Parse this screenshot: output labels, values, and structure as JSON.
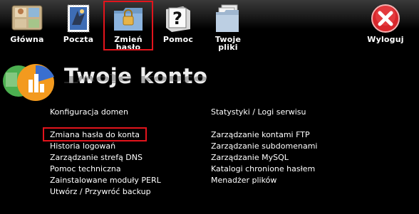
{
  "toolbar": {
    "items": [
      {
        "label": "Główna",
        "icon": "home-photos-icon"
      },
      {
        "label": "Poczta",
        "icon": "mail-stamp-icon"
      },
      {
        "label": "Zmień\nhasło",
        "icon": "folder-password-icon"
      },
      {
        "label": "Pomoc",
        "icon": "help-question-icon"
      },
      {
        "label": "Twoje\npliki",
        "icon": "files-folder-icon"
      },
      {
        "label": "Wyloguj",
        "icon": "logout-close-icon"
      }
    ],
    "highlight_color": "#e3141c"
  },
  "header": {
    "title": "Twoje konto"
  },
  "links": {
    "left": [
      "Konfiguracja domen",
      "Zmiana hasła do konta",
      "Historia logowań",
      "Zarządzanie strefą DNS",
      "Pomoc techniczna",
      "Zainstalowane moduły PERL",
      "Utwórz / Przywróć backup"
    ],
    "right": [
      "Statystyki / Logi serwisu",
      "Zarządzanie kontami FTP",
      "Zarządzanie subdomenami",
      "Zarządzanie MySQL",
      "Katalogi chronione hasłem",
      "Menadżer plików"
    ]
  }
}
